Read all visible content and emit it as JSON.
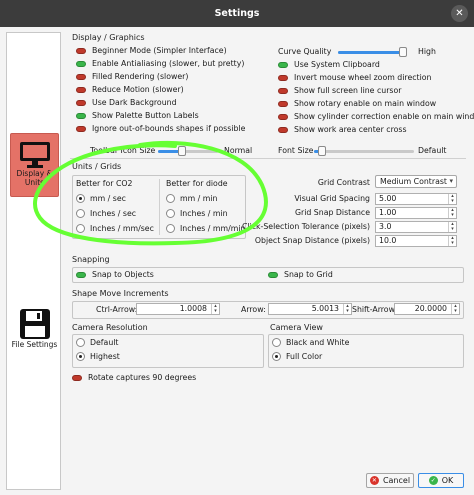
{
  "window": {
    "title": "Settings",
    "close_glyph": "✕"
  },
  "sidebar": {
    "items": [
      {
        "label": "Display & Units",
        "icon": "monitor-icon",
        "active": true
      },
      {
        "label": "File Settings",
        "icon": "floppy-disk-icon",
        "active": false
      }
    ]
  },
  "display": {
    "section_title": "Display / Graphics",
    "left_options": [
      {
        "label": "Beginner Mode (Simpler Interface)",
        "on": false
      },
      {
        "label": "Enable Antialiasing (slower, but pretty)",
        "on": true
      },
      {
        "label": "Filled Rendering (slower)",
        "on": false
      },
      {
        "label": "Reduce Motion (slower)",
        "on": false
      },
      {
        "label": "Use Dark Background",
        "on": false
      },
      {
        "label": "Show Palette Button Labels",
        "on": true
      },
      {
        "label": "Ignore out-of-bounds shapes if possible",
        "on": false
      }
    ],
    "curve_quality": {
      "label": "Curve Quality",
      "value_label": "High",
      "level": 0.95
    },
    "right_options": [
      {
        "label": "Use System Clipboard",
        "on": true
      },
      {
        "label": "Invert mouse wheel zoom direction",
        "on": false
      },
      {
        "label": "Show full screen line cursor",
        "on": false
      },
      {
        "label": "Show rotary enable on main window",
        "on": false
      },
      {
        "label": "Show cylinder correction enable on main window",
        "on": false
      },
      {
        "label": "Show work area center cross",
        "on": false
      }
    ],
    "toolbar_icon_size": {
      "label": "Toolbar Icon Size",
      "value_label": "Normal",
      "level": 0.4
    },
    "font_size": {
      "label": "Font Size",
      "value_label": "Default",
      "level": 0.08
    }
  },
  "units": {
    "section_title": "Units / Grids",
    "co2_title": "Better for CO2",
    "co2_options": [
      {
        "label": "mm / sec",
        "selected": true
      },
      {
        "label": "Inches / sec",
        "selected": false
      },
      {
        "label": "Inches / mm/sec",
        "selected": false
      }
    ],
    "diode_title": "Better for diode",
    "diode_options": [
      {
        "label": "mm / min",
        "selected": false
      },
      {
        "label": "Inches / min",
        "selected": false
      },
      {
        "label": "Inches / mm/min",
        "selected": false
      }
    ],
    "grid_contrast": {
      "label": "Grid Contrast",
      "value": "Medium Contrast"
    },
    "fields": [
      {
        "label": "Visual Grid Spacing",
        "value": "5.00"
      },
      {
        "label": "Grid Snap Distance",
        "value": "1.00"
      },
      {
        "label": "Click-Selection Tolerance (pixels)",
        "value": "3.0"
      },
      {
        "label": "Object Snap Distance (pixels)",
        "value": "10.0"
      }
    ]
  },
  "snapping": {
    "section_title": "Snapping",
    "snap_objects": "Snap to Objects",
    "snap_grid": "Snap to Grid"
  },
  "shape_move": {
    "section_title": "Shape Move Increments",
    "ctrl_label": "Ctrl-Arrow:",
    "ctrl_value": "1.0008",
    "arrow_label": "Arrow:",
    "arrow_value": "5.0013",
    "shift_label": "Shift-Arrow:",
    "shift_value": "20.0000"
  },
  "camera_resolution": {
    "title": "Camera Resolution",
    "options": [
      {
        "label": "Default",
        "selected": false
      },
      {
        "label": "Highest",
        "selected": true
      }
    ]
  },
  "camera_view": {
    "title": "Camera View",
    "options": [
      {
        "label": "Black and White",
        "selected": false
      },
      {
        "label": "Full Color",
        "selected": true
      }
    ]
  },
  "rotate_captures": {
    "label": "Rotate captures 90 degrees",
    "on": false
  },
  "footer": {
    "cancel_label": "Cancel",
    "ok_label": "OK"
  },
  "colors": {
    "accent": "#3a8ee6",
    "on": "#3ab54a",
    "off": "#c0392b",
    "active_tab": "#e47267",
    "annotation": "#66ff33"
  }
}
